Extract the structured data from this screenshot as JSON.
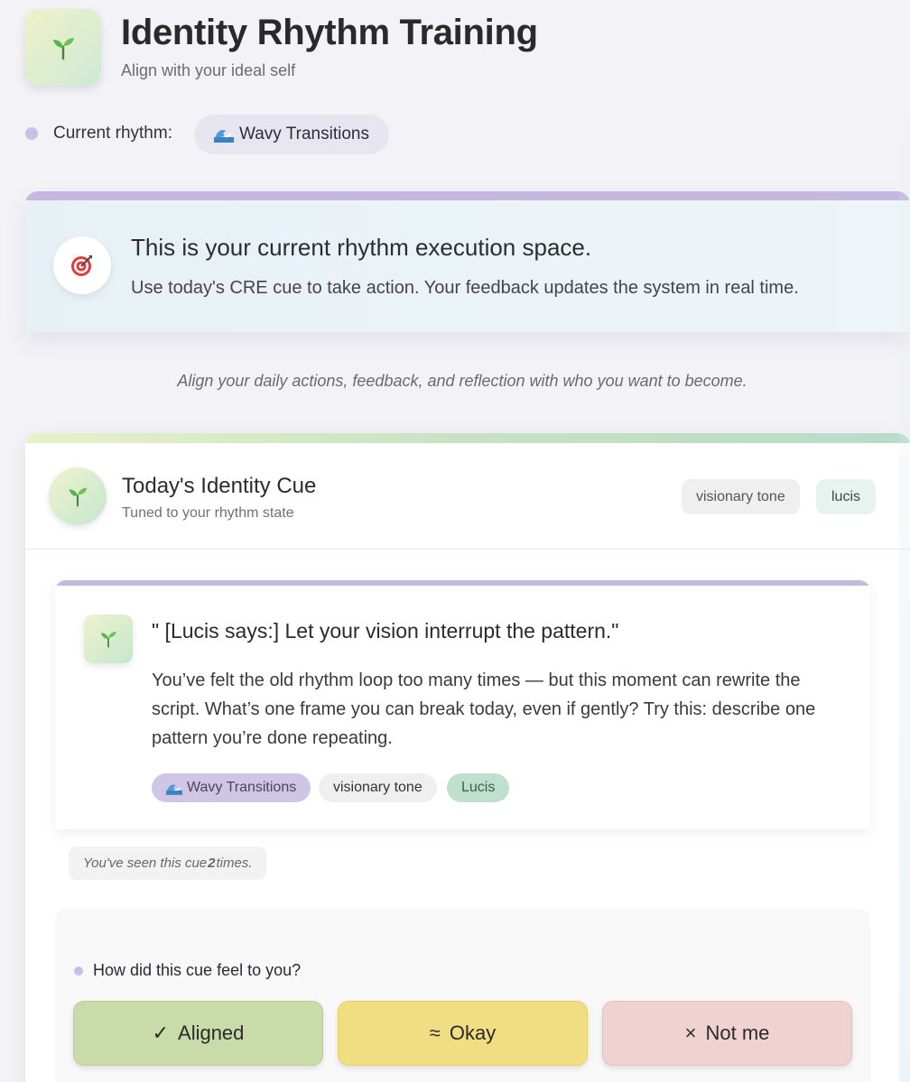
{
  "header": {
    "title": "Identity Rhythm Training",
    "subtitle": "Align with your ideal self",
    "logo_icon": "seedling-icon"
  },
  "rhythm": {
    "label": "Current rhythm:",
    "icon": "wave-icon",
    "value": "Wavy Transitions"
  },
  "banner": {
    "icon": "target-icon",
    "title": "This is your current rhythm execution space.",
    "text": "Use today's CRE cue to take action. Your feedback updates the system in real time."
  },
  "tagline": "Align your daily actions, feedback, and reflection with who you want to become.",
  "cue": {
    "title": "Today's Identity Cue",
    "subtitle": "Tuned to your rhythm state",
    "tags": [
      "visionary tone",
      "lucis"
    ],
    "quote": "\" [Lucis says:] Let your vision interrupt the pattern.\"",
    "body": "You’ve felt the old rhythm loop too many times — but this moment can rewrite the script. What’s one frame you can break today, even if gently? Try this: describe one pattern you’re done repeating.",
    "chips": [
      "Wavy Transitions",
      "visionary tone",
      "Lucis"
    ],
    "seen_prefix": "You've seen this cue ",
    "seen_count": "2",
    "seen_suffix": " times."
  },
  "feedback": {
    "question": "How did this cue feel to you?",
    "buttons": [
      {
        "symbol": "✓",
        "label": "Aligned"
      },
      {
        "symbol": "≈",
        "label": "Okay"
      },
      {
        "symbol": "×",
        "label": "Not me"
      }
    ]
  },
  "colors": {
    "accent_purple": "#c4b8e0",
    "aligned": "#c8dba8",
    "okay": "#f1de82",
    "not_me": "#f0d3d0"
  }
}
